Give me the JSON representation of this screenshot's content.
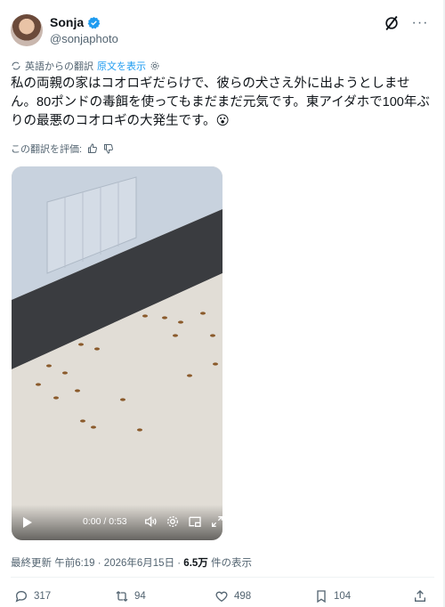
{
  "author": {
    "name": "Sonja",
    "handle": "@sonjaphoto"
  },
  "translation": {
    "note": "英語からの翻訳",
    "show_original": "原文を表示"
  },
  "post": {
    "text": "私の両親の家はコオロギだらけで、彼らの犬さえ外に出ようとしません。80ポンドの毒餌を使ってもまだまだ元気です。東アイダホで100年ぶりの最悪のコオロギの大発生です。",
    "emoji": "😮"
  },
  "rate_translation": "この翻訳を評価:",
  "video": {
    "time": "0:00 / 0:53"
  },
  "meta": {
    "updated": "最終更新 午前6:19 · 2026年6月15日 · ",
    "views": "6.5万",
    "views_suffix": " 件の表示"
  },
  "actions": {
    "replies": "317",
    "reposts": "94",
    "likes": "498",
    "bookmarks": "104"
  },
  "colors": {
    "accent": "#1d9bf0",
    "muted": "#536471",
    "text": "#0f1419"
  }
}
